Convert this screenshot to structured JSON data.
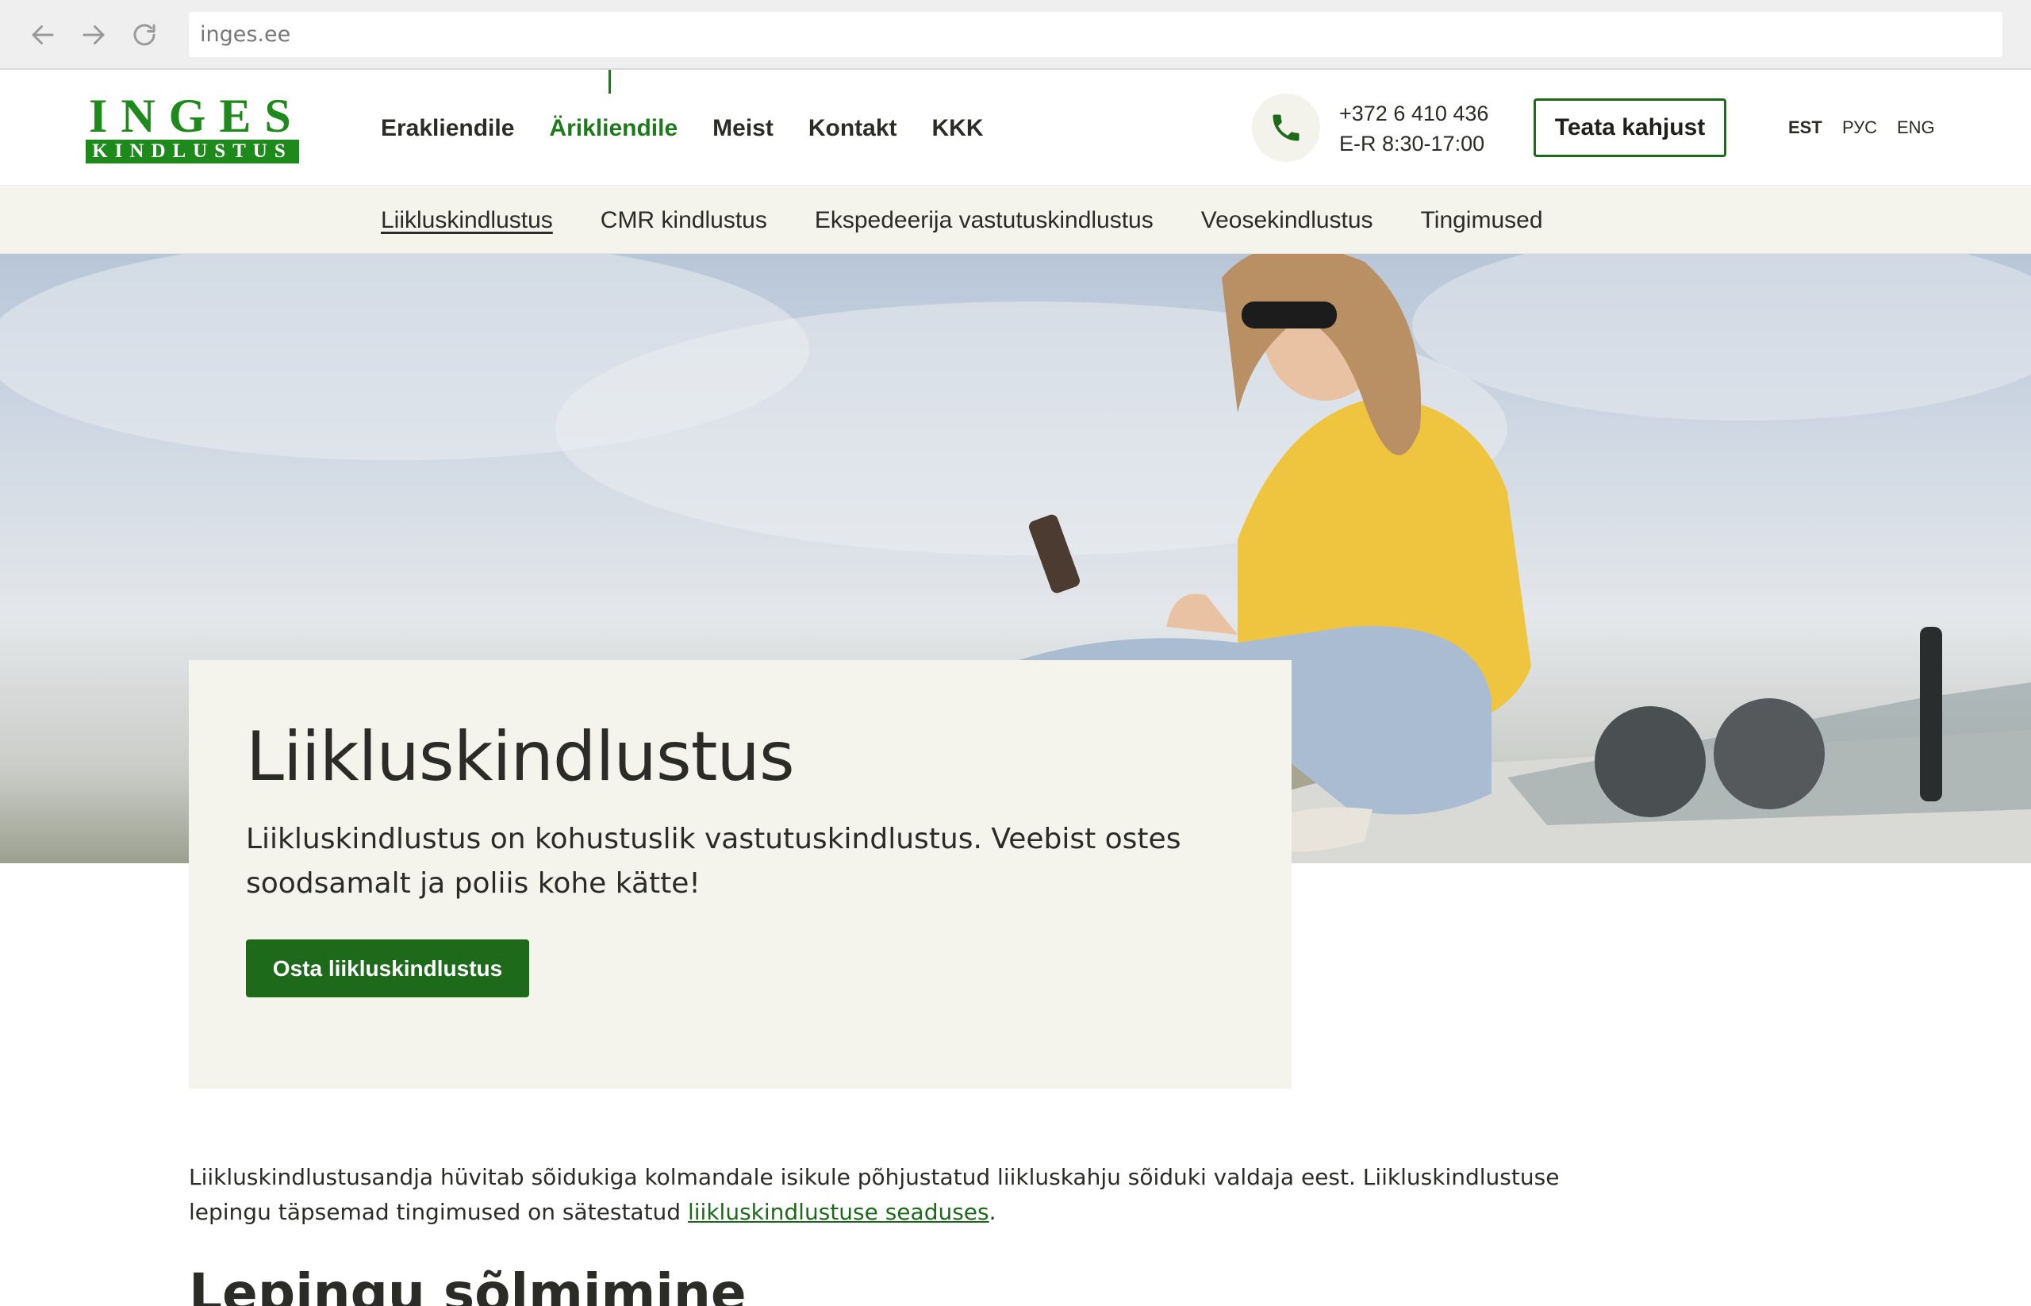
{
  "browser": {
    "url": "inges.ee",
    "back_icon": "arrow-left-icon",
    "forward_icon": "arrow-right-icon",
    "reload_icon": "reload-icon"
  },
  "logo": {
    "top_text": "INGES",
    "bottom_text": "KINDLUSTUS",
    "color": "#1f8a1c"
  },
  "main_nav": [
    {
      "label": "Erakliendile",
      "active": false
    },
    {
      "label": "Ärikliendile",
      "active": true
    },
    {
      "label": "Meist",
      "active": false
    },
    {
      "label": "Kontakt",
      "active": false
    },
    {
      "label": "KKK",
      "active": false
    }
  ],
  "contact": {
    "icon": "phone-icon",
    "phone": "+372 6 410 436",
    "hours": "E-R 8:30-17:00"
  },
  "report_button": "Teata kahjust",
  "languages": [
    {
      "label": "EST",
      "active": true
    },
    {
      "label": "РУС",
      "active": false
    },
    {
      "label": "ENG",
      "active": false
    }
  ],
  "sub_nav": [
    {
      "label": "Liikluskindlustus",
      "active": true
    },
    {
      "label": "CMR kindlustus",
      "active": false
    },
    {
      "label": "Ekspedeerija vastutuskindlustus",
      "active": false
    },
    {
      "label": "Veosekindlustus",
      "active": false
    },
    {
      "label": "Tingimused",
      "active": false
    }
  ],
  "hero": {
    "title": "Liikluskindlustus",
    "description": "Liikluskindlustus on kohustuslik vastutuskindlustus. Veebist ostes soodsamalt ja poliis kohe kätte!",
    "cta": "Osta liikluskindlustus"
  },
  "intro": {
    "text_before": "Liikluskindlustusandja hüvitab sõidukiga kolmandale isikule põhjustatud liikluskahju sõiduki valdaja eest. Liikluskindlustuse lepingu täpsemad tingimused on sätestatud ",
    "link": "liikluskindlustuse seaduses",
    "text_after": "."
  },
  "section_heading": "Lepingu sõlmimine",
  "colors": {
    "brand_green": "#1d6a1a",
    "subnav_bg": "#f4f3ec",
    "text": "#2b2b27"
  }
}
